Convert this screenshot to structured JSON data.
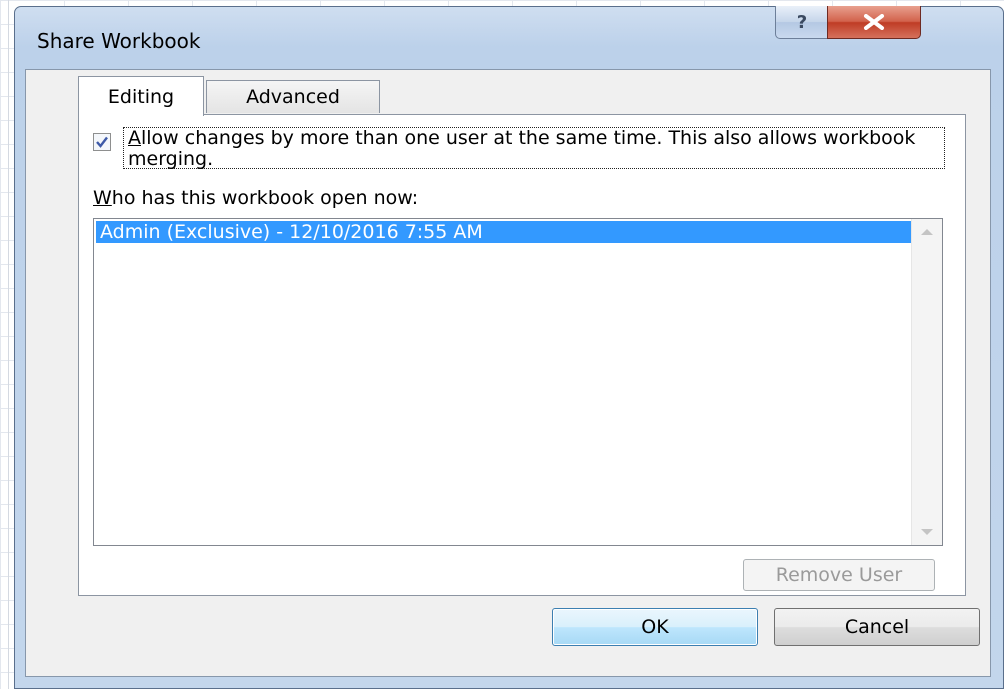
{
  "dialog": {
    "title": "Share Workbook",
    "help_glyph": "?",
    "close_glyph": "X"
  },
  "tabs": [
    {
      "label": "Editing",
      "selected": true
    },
    {
      "label": "Advanced",
      "selected": false
    }
  ],
  "editing": {
    "allow_changes": {
      "checked": true,
      "label_first_letter": "A",
      "label_rest": "llow changes by more than one user at the same time.  This also allows workbook merging."
    },
    "who_label_first_letter": "W",
    "who_label_rest": "ho has this workbook open now:",
    "users": [
      "Admin (Exclusive) - 12/10/2016 7:55 AM"
    ]
  },
  "buttons": {
    "remove_user": "Remove User",
    "ok": "OK",
    "cancel": "Cancel"
  },
  "colors": {
    "selection": "#3399ff",
    "close_button": "#c7432c"
  }
}
